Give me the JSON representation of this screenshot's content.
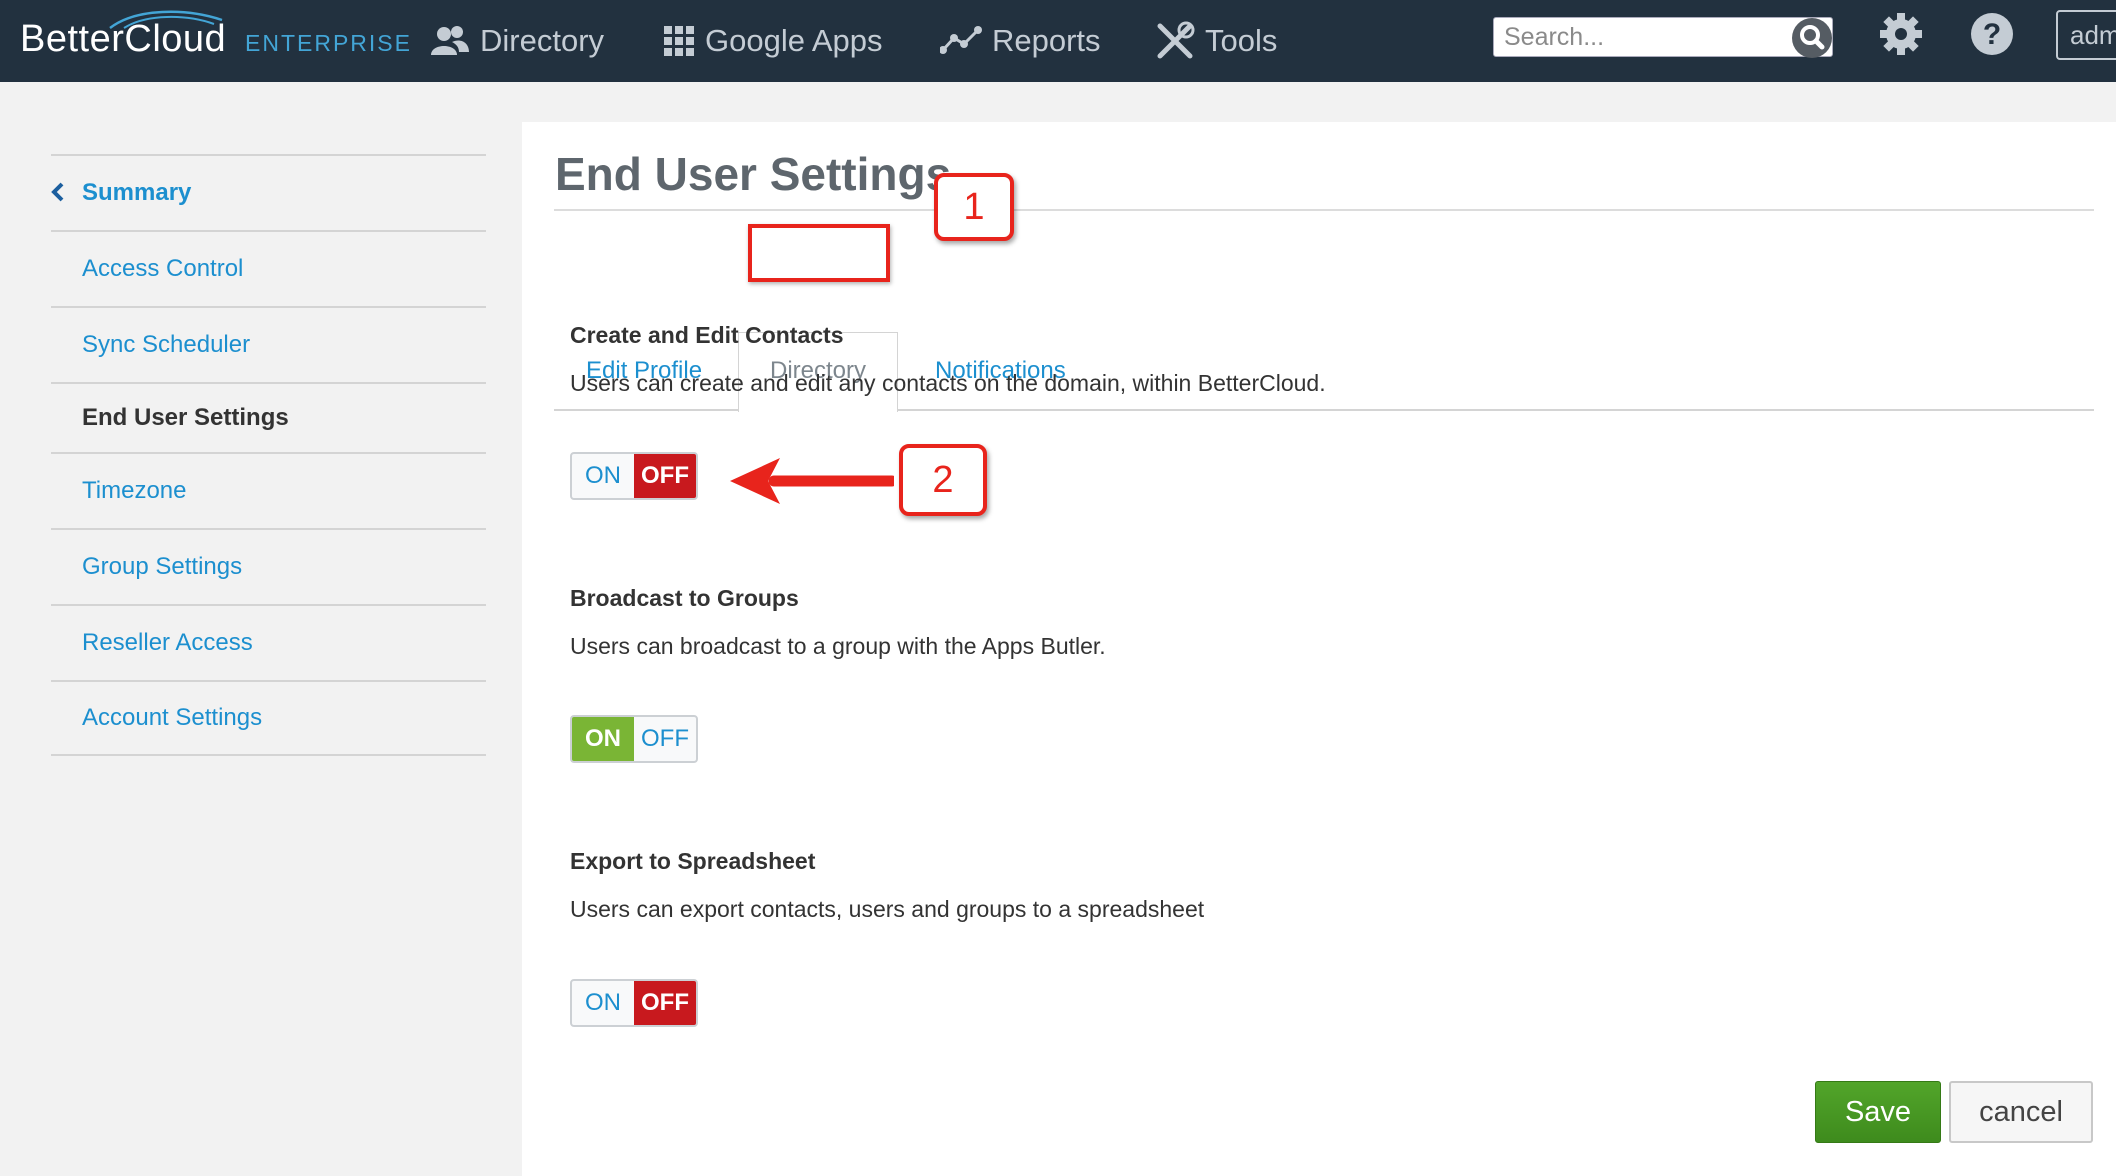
{
  "brand": {
    "name": "BetterCloud",
    "edition": "ENTERPRISE"
  },
  "topnav": {
    "items": [
      {
        "label": "Directory",
        "icon": "users-icon"
      },
      {
        "label": "Google Apps",
        "icon": "grid-icon"
      },
      {
        "label": "Reports",
        "icon": "chart-line-icon"
      },
      {
        "label": "Tools",
        "icon": "tools-icon"
      }
    ],
    "search_placeholder": "Search...",
    "user_label": "adm"
  },
  "sidebar": {
    "items": [
      {
        "label": "Summary"
      },
      {
        "label": "Access Control"
      },
      {
        "label": "Sync Scheduler"
      },
      {
        "label": "End User Settings"
      },
      {
        "label": "Timezone"
      },
      {
        "label": "Group Settings"
      },
      {
        "label": "Reseller Access"
      },
      {
        "label": "Account Settings"
      }
    ],
    "active": "End User Settings"
  },
  "main": {
    "title": "End User Settings",
    "tabs": [
      {
        "label": "Edit Profile"
      },
      {
        "label": "Directory"
      },
      {
        "label": "Notifications"
      }
    ],
    "active_tab": "Directory",
    "sections": [
      {
        "title": "Create and Edit Contacts",
        "description": "Users can create and edit any contacts on the domain, within BetterCloud.",
        "on_label": "ON",
        "off_label": "OFF",
        "state": "OFF"
      },
      {
        "title": "Broadcast to Groups",
        "description": "Users can broadcast to a group with the Apps Butler.",
        "on_label": "ON",
        "off_label": "OFF",
        "state": "ON"
      },
      {
        "title": "Export to Spreadsheet",
        "description": "Users can export contacts, users and groups to a spreadsheet",
        "on_label": "ON",
        "off_label": "OFF",
        "state": "OFF"
      }
    ],
    "save_label": "Save",
    "cancel_label": "cancel"
  },
  "annotations": {
    "callout_1": "1",
    "callout_2": "2"
  },
  "colors": {
    "topnav_bg": "#22313f",
    "link": "#1c8fcf",
    "toggle_off_active": "#c8191e",
    "toggle_on_active": "#7ab535",
    "save_button": "#4a9a25",
    "annotation": "#e8241c"
  }
}
